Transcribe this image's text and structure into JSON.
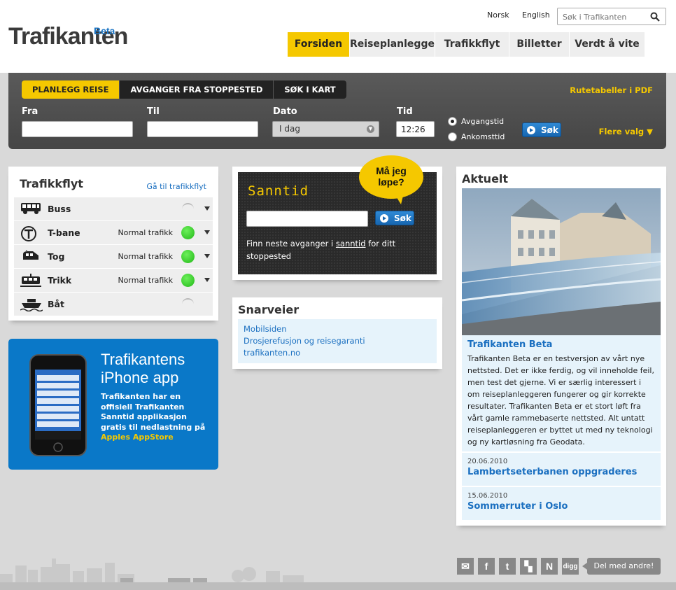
{
  "header": {
    "logo": "Trafikanten",
    "logo_badge": "Beta",
    "lang_no": "Norsk",
    "lang_en": "English",
    "search_placeholder": "Søk i Trafikanten"
  },
  "nav": {
    "tabs": [
      "Forsiden",
      "Reiseplanlegger",
      "Trafikkflyt",
      "Billetter",
      "Verdt å vite"
    ]
  },
  "planner": {
    "tabs": [
      "PLANLEGG REISE",
      "AVGANGER FRA STOPPESTED",
      "SØK I KART"
    ],
    "pdf_link": "Rutetabeller i PDF",
    "from_label": "Fra",
    "to_label": "Til",
    "date_label": "Dato",
    "date_value": "I dag",
    "time_label": "Tid",
    "time_value": "12:26",
    "radio_departure": "Avgangstid",
    "radio_arrival": "Ankomsttid",
    "search_button": "Søk",
    "more_options": "Flere valg"
  },
  "trafikkflyt": {
    "title": "Trafikkflyt",
    "link": "Gå til trafikkflyt",
    "rows": [
      {
        "name": "Buss",
        "status": ""
      },
      {
        "name": "T-bane",
        "status": "Normal trafikk"
      },
      {
        "name": "Tog",
        "status": "Normal trafikk"
      },
      {
        "name": "Trikk",
        "status": "Normal trafikk"
      },
      {
        "name": "Båt",
        "status": ""
      }
    ]
  },
  "iphone_promo": {
    "title1": "Trafikantens",
    "title2": "iPhone app",
    "text": "Trafikanten har en offisiell Trafikanten Sanntid applikasjon gratis til nedlastning på ",
    "link": "Apples AppStore"
  },
  "sanntid": {
    "title": "Sanntid",
    "bubble1": "Må jeg",
    "bubble2": "løpe?",
    "search_button": "Søk",
    "desc_before": "Finn neste avganger i ",
    "desc_link": "sanntid",
    "desc_after": " for ditt stoppested"
  },
  "snarveier": {
    "title": "Snarveier",
    "links": [
      "Mobilsiden",
      "Drosjerefusjon og reisegaranti",
      "trafikanten.no"
    ]
  },
  "aktuelt": {
    "title": "Aktuelt",
    "main_headline": "Trafikanten Beta",
    "main_body": "Trafikanten Beta er en testversjon av vårt nye nettsted. Det er ikke ferdig, og vil inneholde feil, men test det gjerne. Vi er særlig interessert i om reiseplanleggeren fungerer og gir korrekte resultater. Trafikanten Beta er et stort løft fra vårt gamle rammebaserte nettsted. Alt untatt reiseplanleggeren er byttet ut med ny teknologi og ny kartløsning fra Geodata.",
    "news": [
      {
        "date": "20.06.2010",
        "title": "Lambertseterbanen oppgraderes"
      },
      {
        "date": "15.06.2010",
        "title": "Sommerruter i Oslo"
      }
    ]
  },
  "share": {
    "label": "Del med andre!",
    "icons": [
      "mail-icon",
      "facebook-icon",
      "twitter-icon",
      "delicious-icon",
      "nettby-icon",
      "digg-icon"
    ],
    "glyphs": [
      "✉",
      "f",
      "t",
      "▚",
      "N",
      "digg"
    ]
  }
}
